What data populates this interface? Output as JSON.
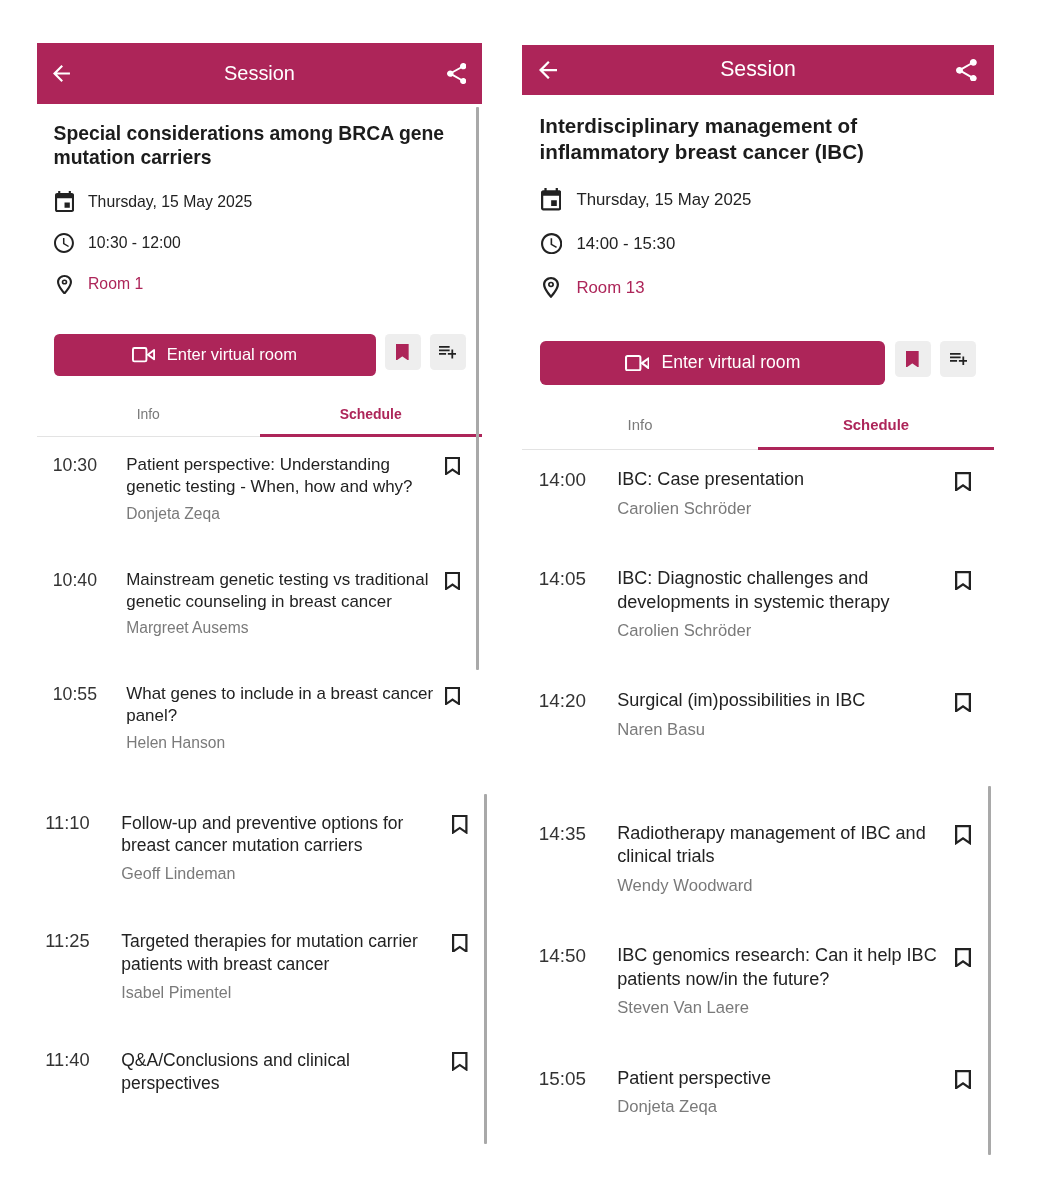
{
  "screens": [
    {
      "header": {
        "title": "Session"
      },
      "session": {
        "title": "Special considerations among BRCA gene mutation carriers",
        "date": "Thursday, 15 May 2025",
        "time": "10:30 - 12:00",
        "room": "Room 1"
      },
      "actions": {
        "virtual_room": "Enter virtual room",
        "bookmarked": true
      },
      "tabs": [
        {
          "label": "Info",
          "selected": false
        },
        {
          "label": "Schedule",
          "selected": true
        }
      ],
      "scrollbar": true,
      "schedule": [
        {
          "time": "10:30",
          "title": "Patient perspective: Understanding genetic testing - When, how and why?",
          "speaker": "Donjeta Zeqa",
          "bookmarked": false
        },
        {
          "time": "10:40",
          "title": "Mainstream genetic testing vs traditional genetic counseling in breast cancer",
          "speaker": "Margreet Ausems",
          "bookmarked": false
        },
        {
          "time": "10:55",
          "title": "What genes to include in a breast cancer panel?",
          "speaker": "Helen Hanson",
          "bookmarked": false
        }
      ],
      "schedule_continued": {
        "scrollbar": true,
        "items": [
          {
            "time": "11:10",
            "title": "Follow-up and preventive options for breast cancer mutation carriers",
            "speaker": "Geoff Lindeman",
            "bookmarked": false
          },
          {
            "time": "11:25",
            "title": "Targeted therapies for mutation carrier patients with breast cancer",
            "speaker": "Isabel Pimentel",
            "bookmarked": false
          },
          {
            "time": "11:40",
            "title": "Q&A/Conclusions and clinical perspectives",
            "bookmarked": false
          }
        ]
      }
    },
    {
      "header": {
        "title": "Session"
      },
      "session": {
        "title": "Interdisciplinary management of inflammatory breast cancer (IBC)",
        "date": "Thursday, 15 May 2025",
        "time": "14:00 - 15:30",
        "room": "Room 13"
      },
      "actions": {
        "virtual_room": "Enter virtual room",
        "bookmarked": true
      },
      "tabs": [
        {
          "label": "Info",
          "selected": false
        },
        {
          "label": "Schedule",
          "selected": true
        }
      ],
      "schedule": [
        {
          "time": "14:00",
          "title": "IBC: Case presentation",
          "speaker": "Carolien Schröder",
          "bookmarked": false
        },
        {
          "time": "14:05",
          "title": "IBC: Diagnostic challenges and developments in systemic therapy",
          "speaker": "Carolien Schröder",
          "bookmarked": false
        },
        {
          "time": "14:20",
          "title": "Surgical (im)possibilities in IBC",
          "speaker": "Naren Basu",
          "bookmarked": false
        }
      ],
      "schedule_continued": {
        "scrollbar": true,
        "items": [
          {
            "time": "14:35",
            "title": "Radiotherapy management of IBC and clinical trials",
            "speaker": "Wendy Woodward",
            "bookmarked": false
          },
          {
            "time": "14:50",
            "title": "IBC genomics research: Can it help IBC patients now/in the future?",
            "speaker": "Steven Van Laere",
            "bookmarked": false
          },
          {
            "time": "15:05",
            "title": "Patient perspective",
            "speaker": "Donjeta Zeqa",
            "bookmarked": false
          }
        ]
      }
    }
  ]
}
